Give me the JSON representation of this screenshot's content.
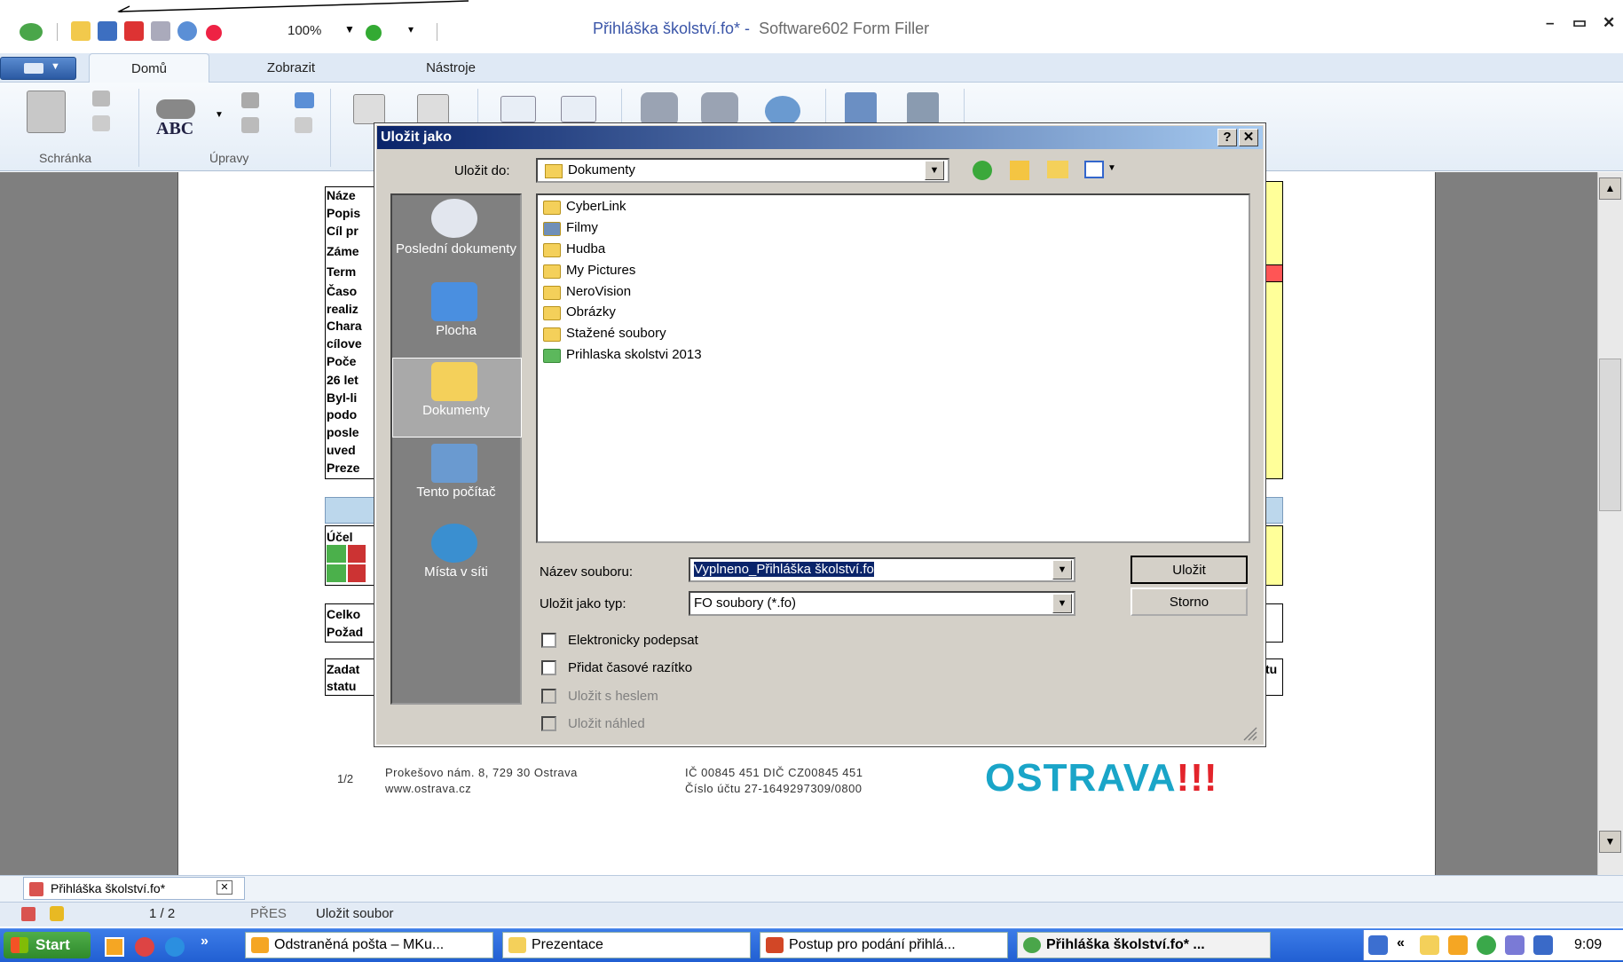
{
  "app": {
    "doc_title": "Přihláška školství.fo* -",
    "app_name": "Software602 Form Filler",
    "zoom": "100%",
    "window_controls": [
      "–",
      "▭",
      "✕"
    ]
  },
  "ribbon": {
    "tabs": [
      "Domů",
      "Zobrazit",
      "Nástroje"
    ],
    "groups": [
      "Schránka",
      "Úpravy"
    ],
    "spell_label": "ABC"
  },
  "document": {
    "row_labels": [
      "Náze",
      "Popis",
      "Cíl pr",
      "Záme",
      "Term",
      "Časo",
      "realiz",
      "Chara",
      "cílove",
      "Poče",
      "26 let",
      "Byl-li",
      "podo",
      "posle",
      "uved",
      "Preze"
    ],
    "purpose_label": "Účel",
    "total_labels": [
      "Celko",
      "Požad"
    ],
    "applicant_labels": [
      "Zadat",
      "statu"
    ],
    "right_fragment": "tu",
    "footer": {
      "page": "1/2",
      "address_1": "Prokešovo nám. 8, 729 30 Ostrava",
      "address_2": "www.ostrava.cz",
      "ids_1": "IČ 00845 451 DIČ CZ00845 451",
      "ids_2": "Číslo účtu 27-1649297309/0800",
      "logo": "OSTRAVA",
      "logo_marks": "!!!"
    }
  },
  "dialog": {
    "title": "Uložit jako",
    "title_buttons": [
      "?",
      "✕"
    ],
    "save_in_label": "Uložit do:",
    "save_in_value": "Dokumenty",
    "places": [
      {
        "label": "Poslední dokumenty",
        "icon": "recent-documents-icon"
      },
      {
        "label": "Plocha",
        "icon": "desktop-icon"
      },
      {
        "label": "Dokumenty",
        "icon": "documents-folder-icon"
      },
      {
        "label": "Tento počítač",
        "icon": "computer-icon"
      },
      {
        "label": "Místa v síti",
        "icon": "network-places-icon"
      }
    ],
    "files": [
      {
        "name": "CyberLink",
        "icon": "folder-icon"
      },
      {
        "name": "Filmy",
        "icon": "video-folder-icon"
      },
      {
        "name": "Hudba",
        "icon": "music-folder-icon"
      },
      {
        "name": "My Pictures",
        "icon": "folder-icon"
      },
      {
        "name": "NeroVision",
        "icon": "folder-icon"
      },
      {
        "name": "Obrázky",
        "icon": "pictures-folder-icon"
      },
      {
        "name": "Stažené soubory",
        "icon": "folder-icon"
      },
      {
        "name": "Prihlaska skolstvi 2013",
        "icon": "form-file-icon"
      }
    ],
    "filename_label": "Název souboru:",
    "filename_value": "Vyplneno_Přihláška školství.fo",
    "filetype_label": "Uložit jako typ:",
    "filetype_value": "FO soubory (*.fo)",
    "save_button": "Uložit",
    "cancel_button": "Storno",
    "options": [
      {
        "label": "Elektronicky podepsat",
        "enabled": true,
        "checked": false
      },
      {
        "label": "Přidat časové razítko",
        "enabled": true,
        "checked": false
      },
      {
        "label": "Uložit s heslem",
        "enabled": false,
        "checked": false
      },
      {
        "label": "Uložit náhled",
        "enabled": false,
        "checked": false
      }
    ]
  },
  "doc_tab": {
    "label": "Přihláška školství.fo*",
    "close": "✕"
  },
  "status": {
    "page": "1 / 2",
    "mode": "PŘES",
    "message": "Uložit soubor"
  },
  "taskbar": {
    "start": "Start",
    "chevron": "»",
    "tasks": [
      {
        "label": "Odstraněná pošta – MKu...",
        "icon": "outlook-icon"
      },
      {
        "label": "Prezentace",
        "icon": "folder-icon"
      },
      {
        "label": "Postup pro podání přihlá...",
        "icon": "powerpoint-icon"
      },
      {
        "label": "Přihláška školství.fo* ...",
        "icon": "form-filler-icon"
      }
    ],
    "tray_chevron": "«",
    "clock": "9:09"
  }
}
